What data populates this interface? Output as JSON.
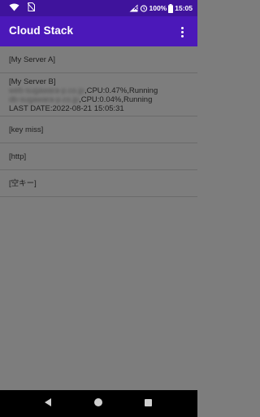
{
  "status_bar": {
    "battery_percent": "100%",
    "time": "15:05"
  },
  "app_bar": {
    "title": "Cloud Stack"
  },
  "servers": [
    {
      "label": "[My Server A]"
    },
    {
      "label": "[My Server B]",
      "line2_host": "web-sugawara-p.co.jp",
      "line2_status": ",CPU:0.47%,Running",
      "line3_host": "db-sugawara-p.co.jp",
      "line3_status": ",CPU:0.04%,Running",
      "last_date": "LAST DATE:2022-08-21 15:05:31"
    },
    {
      "label": "[key miss]"
    },
    {
      "label": "[http]"
    },
    {
      "label": "[空キー]"
    }
  ],
  "colors": {
    "status_bar_bg": "#3f139c",
    "app_bar_bg": "#4b18b9",
    "list_bg": "#7d7d7d"
  }
}
